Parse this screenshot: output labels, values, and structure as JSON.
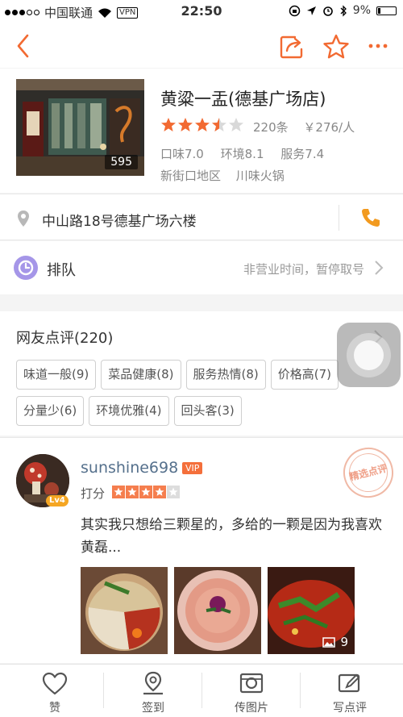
{
  "status_bar": {
    "carrier": "中国联通",
    "vpn": "VPN",
    "time": "22:50",
    "battery": "9%"
  },
  "nav": {
    "back_icon": "chevron-left-icon",
    "share_icon": "share-icon",
    "favorite_icon": "star-outline-icon",
    "more_icon": "more-dots-icon",
    "accent_color": "#f26a32"
  },
  "shop": {
    "name": "黄粱一盂(德基广场店)",
    "photo_count": "595",
    "rating": 3.5,
    "rating_max": 5,
    "review_count": "220条",
    "price": "￥276/人",
    "scores": [
      "口味7.0",
      "环境8.1",
      "服务7.4"
    ],
    "area": "新街口地区",
    "category": "川味火锅"
  },
  "address": {
    "text": "中山路18号德基广场六楼",
    "pin_icon": "location-pin-icon",
    "phone_icon": "phone-icon"
  },
  "queue": {
    "label": "排队",
    "status": "非营业时间，暂停取号",
    "icon": "clock-icon"
  },
  "reviews": {
    "title": "网友点评(220)",
    "tags_row1": [
      "味道一般(9)",
      "菜品健康(8)",
      "服务热情(8)",
      "价格高(7)"
    ],
    "tags_row2": [
      "分量少(6)",
      "环境优雅(4)",
      "回头客(3)"
    ]
  },
  "review": {
    "user": "sunshine698",
    "vip": "VIP",
    "level": "Lv4",
    "score_label": "打分",
    "score": 4,
    "score_max": 5,
    "stamp": "精选点评",
    "text": "其实我只想给三颗星的，多给的一颗是因为我喜欢黄磊...",
    "photo_more_count": "9"
  },
  "tabbar": {
    "items": [
      {
        "label": "赞",
        "icon": "heart-icon"
      },
      {
        "label": "签到",
        "icon": "map-pin-icon"
      },
      {
        "label": "传图片",
        "icon": "camera-icon"
      },
      {
        "label": "写点评",
        "icon": "edit-icon"
      }
    ]
  }
}
